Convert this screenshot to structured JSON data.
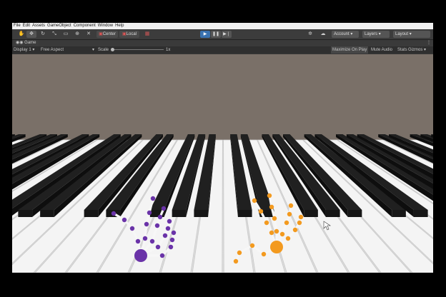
{
  "menu": [
    "File",
    "Edit",
    "Assets",
    "GameObject",
    "Component",
    "Window",
    "Help"
  ],
  "toolbar": {
    "tools": [
      "hand-tool-icon",
      "move-tool-icon",
      "rotate-tool-icon",
      "scale-tool-icon",
      "rect-tool-icon",
      "transform-tool-icon",
      "custom-tool-icon"
    ],
    "pivot": "Center",
    "space": "Local",
    "account": "Account",
    "layers": "Layers",
    "layout": "Layout",
    "play_active": true,
    "accent": "#3a72b0"
  },
  "game_tab": {
    "label": "Game"
  },
  "game_controls": {
    "display": "Display 1",
    "aspect": "Free Aspect",
    "scale_label": "Scale",
    "scale_value": "1x",
    "maximize": "Maximize On Play",
    "mute": "Mute Audio",
    "stats": "Stats",
    "gizmos": "Gizmos"
  },
  "scene_colors": {
    "background": "#7a7068",
    "white_key": "#f4f4f4",
    "black_key": "#202020",
    "left_hand": "#6a33a8",
    "right_hand": "#f39a1f"
  }
}
